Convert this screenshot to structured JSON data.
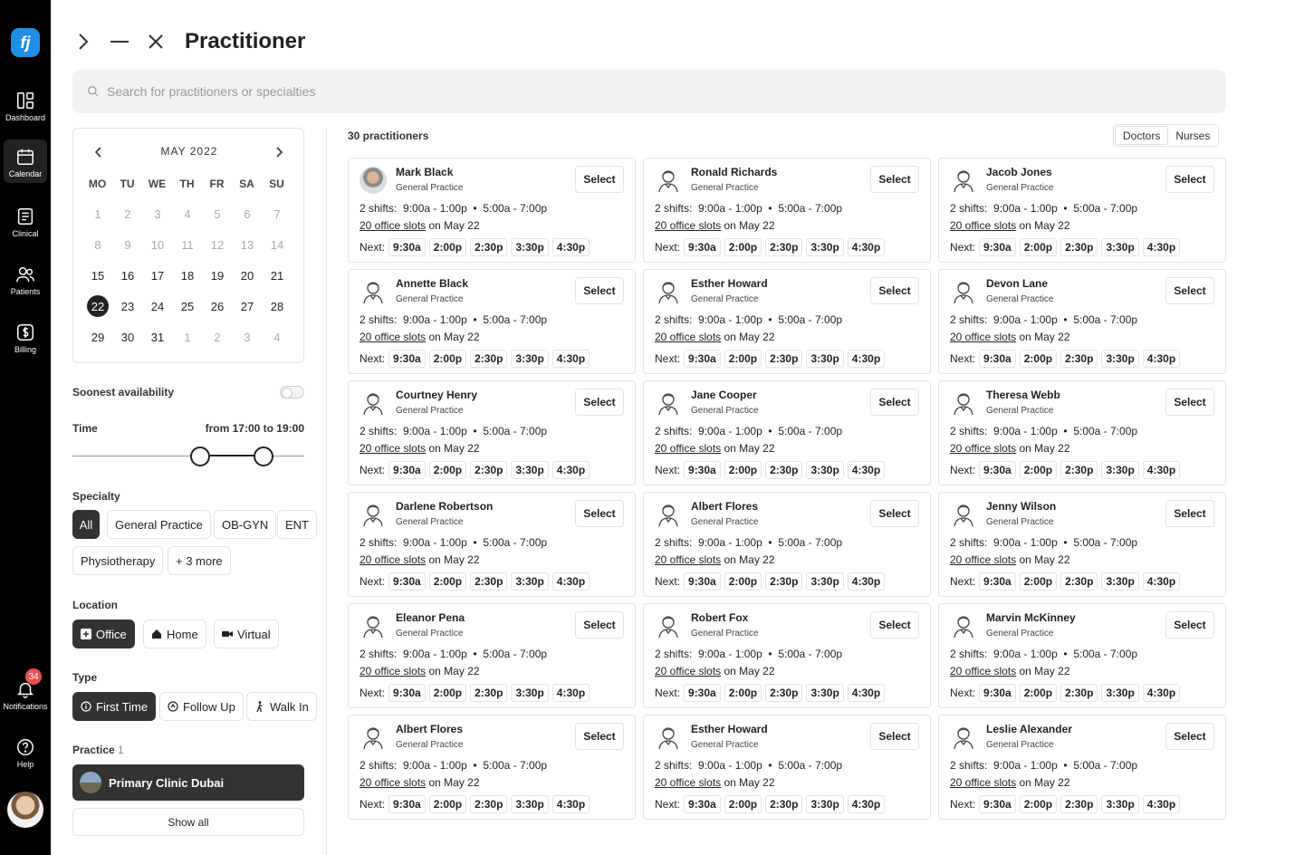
{
  "nav": {
    "items": [
      {
        "label": "Dashboard",
        "icon": "dashboard-icon"
      },
      {
        "label": "Calendar",
        "icon": "calendar-icon"
      },
      {
        "label": "Clinical",
        "icon": "clinical-icon"
      },
      {
        "label": "Patients",
        "icon": "patients-icon"
      },
      {
        "label": "Billing",
        "icon": "billing-icon"
      }
    ],
    "notifications_label": "Notifications",
    "notifications_count": "34",
    "help_label": "Help",
    "logo_text": "fj"
  },
  "header": {
    "title": "Practitioner"
  },
  "search": {
    "placeholder": "Search for practitioners or specialties"
  },
  "calendar": {
    "month": "MAY 2022",
    "weekdays": [
      "MO",
      "TU",
      "WE",
      "TH",
      "FR",
      "SA",
      "SU"
    ],
    "weeks": [
      [
        "1",
        "2",
        "3",
        "4",
        "5",
        "6",
        "7"
      ],
      [
        "8",
        "9",
        "10",
        "11",
        "12",
        "13",
        "14"
      ],
      [
        "15",
        "16",
        "17",
        "18",
        "19",
        "20",
        "21"
      ],
      [
        "22",
        "23",
        "24",
        "25",
        "26",
        "27",
        "28"
      ],
      [
        "29",
        "30",
        "31",
        "1",
        "2",
        "3",
        "4"
      ]
    ],
    "selected": "22"
  },
  "filters": {
    "soonest_label": "Soonest availability",
    "time_label": "Time",
    "time_range": "from 17:00 to 19:00",
    "specialty_label": "Specialty",
    "specialties": [
      "All",
      "General Practice",
      "OB-GYN",
      "ENT",
      "Physiotherapy",
      "+ 3 more"
    ],
    "location_label": "Location",
    "locations": [
      "Office",
      "Home",
      "Virtual"
    ],
    "type_label": "Type",
    "types": [
      "First Time",
      "Follow Up",
      "Walk In"
    ],
    "practice_label": "Practice",
    "practice_count": "1",
    "practice_name": "Primary Clinic Dubai",
    "show_all": "Show all"
  },
  "results": {
    "count_label": "30 practitioners",
    "tabs": [
      "Doctors",
      "Nurses"
    ],
    "select_label": "Select",
    "specialty": "General Practice",
    "shifts_prefix": "2 shifts:",
    "shift1": "9:00a - 1:00p",
    "shift2": "5:00a - 7:00p",
    "slots_link": "20 office slots",
    "slots_suffix": "on May 22",
    "next_label": "Next:",
    "times": [
      "9:30a",
      "2:00p",
      "2:30p",
      "3:30p",
      "4:30p"
    ],
    "practitioners": [
      "Mark Black",
      "Ronald Richards",
      "Jacob Jones",
      "Annette Black",
      "Esther Howard",
      "Devon Lane",
      "Courtney Henry",
      "Jane Cooper",
      "Theresa Webb",
      "Darlene Robertson",
      "Albert Flores",
      "Jenny Wilson",
      "Eleanor Pena",
      "Robert Fox",
      "Marvin McKinney",
      "Albert Flores",
      "Esther Howard",
      "Leslie Alexander"
    ]
  },
  "colors": {
    "accent": "#1f8fe6",
    "dark": "#333333",
    "badge": "#ef4f4f"
  }
}
